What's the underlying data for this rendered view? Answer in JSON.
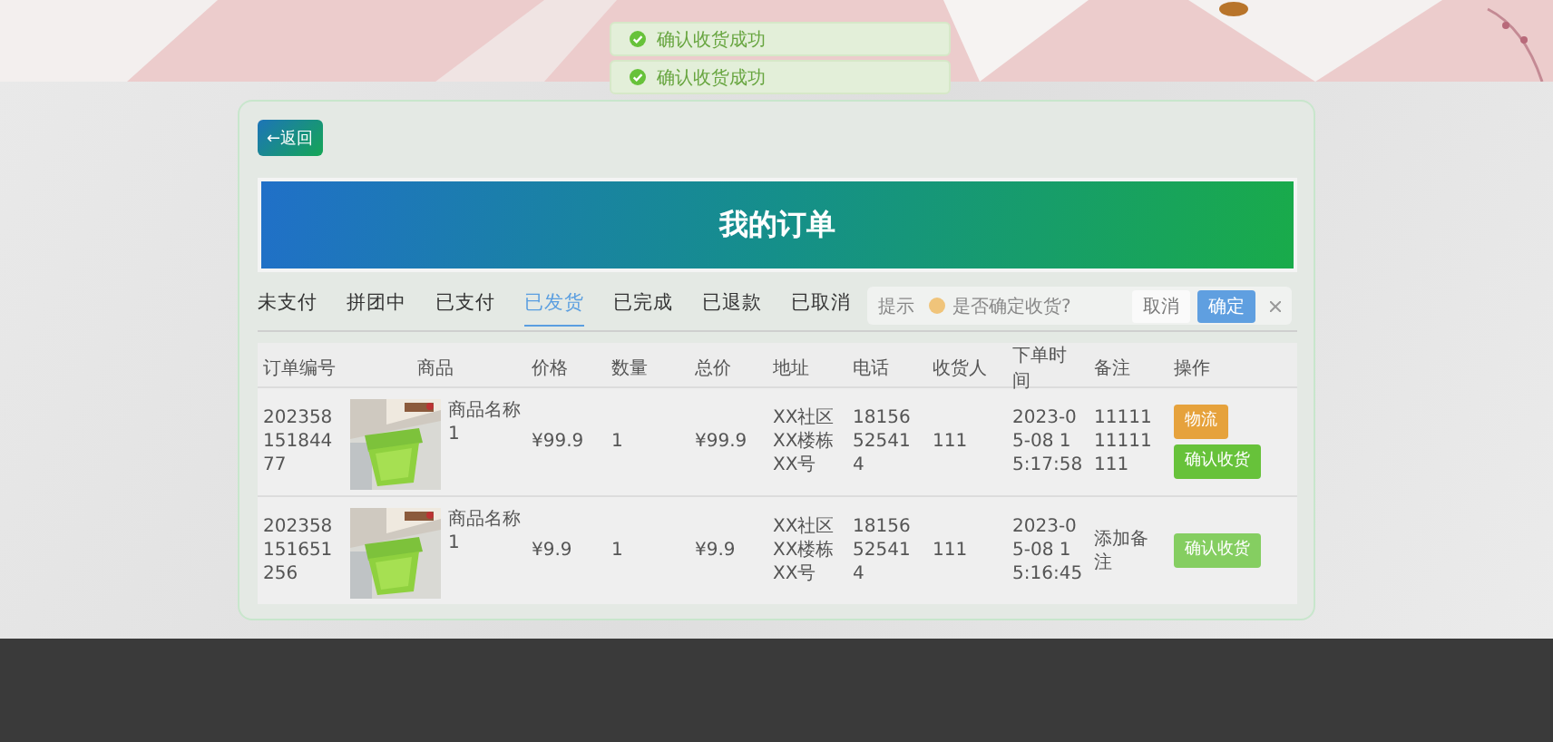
{
  "toasts": [
    {
      "text": "确认收货成功"
    },
    {
      "text": "确认收货成功"
    }
  ],
  "back_button": "←返回",
  "header": {
    "title": "我的订单"
  },
  "tabs": [
    {
      "label": "未支付",
      "selected": false
    },
    {
      "label": "拼团中",
      "selected": false
    },
    {
      "label": "已支付",
      "selected": false
    },
    {
      "label": "已发货",
      "selected": true
    },
    {
      "label": "已完成",
      "selected": false
    },
    {
      "label": "已退款",
      "selected": false
    },
    {
      "label": "已取消",
      "selected": false
    }
  ],
  "table": {
    "columns": [
      "订单编号",
      "商品",
      "价格",
      "数量",
      "总价",
      "地址",
      "电话",
      "收货人",
      "下单时间",
      "备注",
      "操作"
    ],
    "rows": [
      {
        "order_no": "20235815184477",
        "product": {
          "kind": "picture",
          "name": "商品名称1"
        },
        "price": "¥99.9",
        "quantity": "1",
        "total": "¥99.9",
        "address": "XX社区XX楼栋XX号",
        "phone": "18156525414",
        "recipient": "111",
        "order_time": "2023-05-08 15:17:58",
        "remark": "1111111111111",
        "actions": [
          {
            "label": "物流",
            "kind": "logistics",
            "hovered": false
          },
          {
            "label": "确认收货",
            "kind": "confirm",
            "hovered": false
          }
        ]
      },
      {
        "order_no": "202358151651256",
        "product": {
          "kind": "picture",
          "name": "商品名称1"
        },
        "price": "¥9.9",
        "quantity": "1",
        "total": "¥9.9",
        "address": "XX社区XX楼栋XX号",
        "phone": "18156525414",
        "recipient": "111",
        "order_time": "2023-05-08 15:16:45",
        "remark": "添加备注",
        "actions": [
          {
            "label": "确认收货",
            "kind": "confirm",
            "hovered": true
          }
        ]
      }
    ]
  },
  "dialog": {
    "title": "提示",
    "message": "是否确定收货?",
    "buttons": [
      {
        "label": "取消",
        "kind": "cancel"
      },
      {
        "label": "确定",
        "kind": "primary"
      }
    ]
  }
}
